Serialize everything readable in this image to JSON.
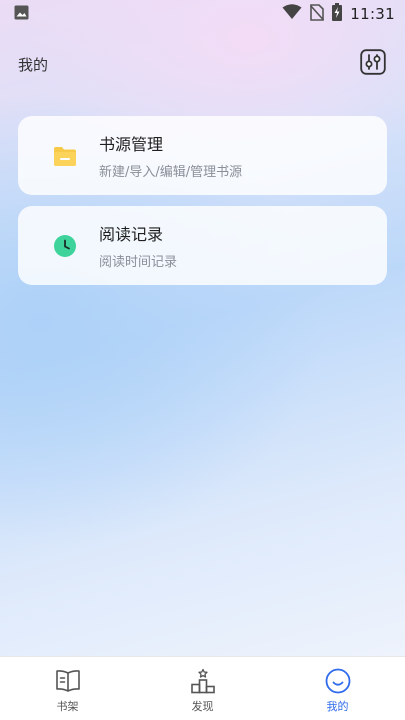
{
  "status_bar": {
    "time": "11:31",
    "icons": [
      "image-icon",
      "wifi-icon",
      "no-sim-icon",
      "battery-charging-icon"
    ]
  },
  "header": {
    "title": "我的",
    "settings_icon": "sliders-icon"
  },
  "cards": [
    {
      "title": "书源管理",
      "subtitle": "新建/导入/编辑/管理书源",
      "icon": "folder-icon",
      "icon_color": "#f7c948"
    },
    {
      "title": "阅读记录",
      "subtitle": "阅读时间记录",
      "icon": "clock-icon",
      "icon_color": "#3dd39a"
    }
  ],
  "bottom_nav": {
    "items": [
      {
        "label": "书架",
        "icon": "book-icon",
        "active": false
      },
      {
        "label": "发现",
        "icon": "podium-icon",
        "active": false
      },
      {
        "label": "我的",
        "icon": "smiley-icon",
        "active": true
      }
    ],
    "active_color": "#2f6bea"
  }
}
